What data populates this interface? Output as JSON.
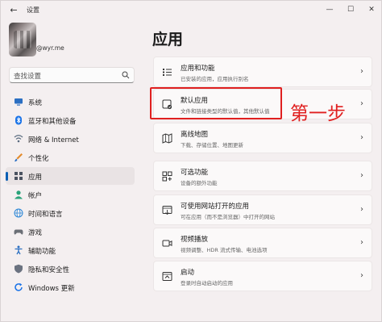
{
  "window": {
    "title": "设置",
    "back_glyph": "←",
    "minimize_glyph": "—",
    "maximize_glyph": "☐",
    "close_glyph": "✕"
  },
  "profile": {
    "email": "@wyr.me"
  },
  "search": {
    "placeholder": "查找设置"
  },
  "sidebar": {
    "items": [
      {
        "label": "系统",
        "icon": "monitor-icon",
        "color": "#2b6fc2"
      },
      {
        "label": "蓝牙和其他设备",
        "icon": "bluetooth-icon",
        "color": "#1a73e8"
      },
      {
        "label": "网络 & Internet",
        "icon": "network-icon",
        "color": "#5a6b7f"
      },
      {
        "label": "个性化",
        "icon": "brush-icon",
        "color": "#e38b2c"
      },
      {
        "label": "应用",
        "icon": "apps-icon",
        "color": "#4a5260",
        "active": true
      },
      {
        "label": "帐户",
        "icon": "account-icon",
        "color": "#2aa37a"
      },
      {
        "label": "时间和语言",
        "icon": "globe-icon",
        "color": "#2b86d6"
      },
      {
        "label": "游戏",
        "icon": "gamepad-icon",
        "color": "#6b6f76"
      },
      {
        "label": "辅助功能",
        "icon": "accessibility-icon",
        "color": "#2b6fc2"
      },
      {
        "label": "隐私和安全性",
        "icon": "shield-icon",
        "color": "#6b7280"
      },
      {
        "label": "Windows 更新",
        "icon": "update-icon",
        "color": "#1a73e8"
      }
    ]
  },
  "main": {
    "title": "应用",
    "cards": [
      {
        "title": "应用和功能",
        "desc": "已安装的应用，应用执行别名",
        "icon": "list-icon"
      },
      {
        "title": "默认应用",
        "desc": "文件和链接类型的默认值，其他默认值",
        "icon": "default-apps-icon"
      },
      {
        "title": "离线地图",
        "desc": "下载、存储位置、地图更新",
        "icon": "map-icon"
      },
      {
        "title": "可选功能",
        "desc": "设备的额外功能",
        "icon": "optional-features-icon"
      },
      {
        "title": "可使用网站打开的应用",
        "desc": "可在应用（而不是浏览器）中打开的网站",
        "icon": "web-apps-icon"
      },
      {
        "title": "视频播放",
        "desc": "视频调整、HDR 流式传输、电池选项",
        "icon": "video-icon"
      },
      {
        "title": "启动",
        "desc": "登录时自动启动的应用",
        "icon": "startup-icon"
      }
    ],
    "chevron_glyph": "›"
  },
  "annotation": {
    "text": "第一步",
    "color": "#e02020"
  }
}
